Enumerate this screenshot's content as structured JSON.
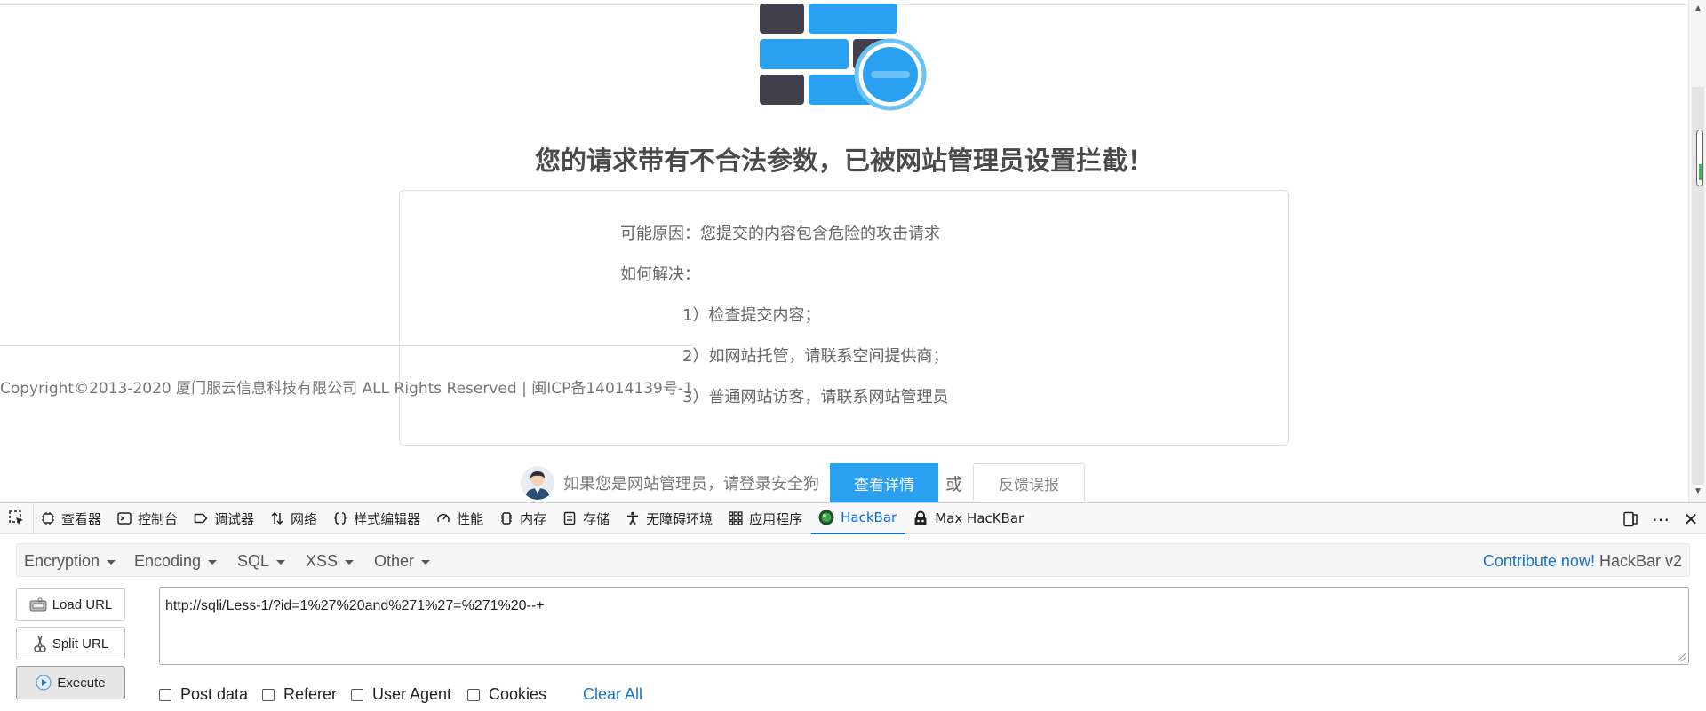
{
  "page": {
    "block_title": "您的请求带有不合法参数，已被网站管理员设置拦截！",
    "reason": "可能原因：您提交的内容包含危险的攻击请求",
    "how_to_solve": "如何解决：",
    "steps": [
      "1）检查提交内容；",
      "2）如网站托管，请联系空间提供商；",
      "3）普通网站访客，请联系网站管理员"
    ],
    "copyright": "Copyright©2013-2020 厦门服云信息科技有限公司 ALL Rights Reserved | 闽ICP备14014139号-1",
    "admin_prompt": "如果您是网站管理员，请登录安全狗",
    "detail_button": "查看详情",
    "or_text": "或",
    "feedback_button": "反馈误报",
    "colors": {
      "wall_dark": "#42404d",
      "wall_blue": "#2aa0f0",
      "accent": "#2aa0f0"
    }
  },
  "page_scrollbar": {
    "up_arrow": "▲",
    "down_arrow": "▼"
  },
  "devtools": {
    "tabs": [
      {
        "label": "查看器",
        "icon": "inspector-icon"
      },
      {
        "label": "控制台",
        "icon": "console-icon"
      },
      {
        "label": "调试器",
        "icon": "debugger-icon"
      },
      {
        "label": "网络",
        "icon": "network-icon"
      },
      {
        "label": "样式编辑器",
        "icon": "braces-icon"
      },
      {
        "label": "性能",
        "icon": "gauge-icon"
      },
      {
        "label": "内存",
        "icon": "memory-icon"
      },
      {
        "label": "存储",
        "icon": "storage-icon"
      },
      {
        "label": "无障碍环境",
        "icon": "accessibility-icon"
      },
      {
        "label": "应用程序",
        "icon": "grid-icon"
      },
      {
        "label": "HackBar",
        "icon": "hackbar-icon",
        "active": true
      },
      {
        "label": "Max HacKBar",
        "icon": "max-hackbar-icon"
      }
    ],
    "more_icon": "⋯",
    "close_icon": "✕"
  },
  "hackbar": {
    "menu": [
      "Encryption",
      "Encoding",
      "SQL",
      "XSS",
      "Other"
    ],
    "contribute_link": "Contribute now!",
    "version": " HackBar v2",
    "load_url": "Load URL",
    "split_url": "Split URL",
    "execute": "Execute",
    "url": "http://sqli/Less-1/?id=1%27%20and%271%27=%271%20--+",
    "checkboxes": [
      "Post data",
      "Referer",
      "User Agent",
      "Cookies"
    ],
    "clear_all": "Clear All"
  }
}
